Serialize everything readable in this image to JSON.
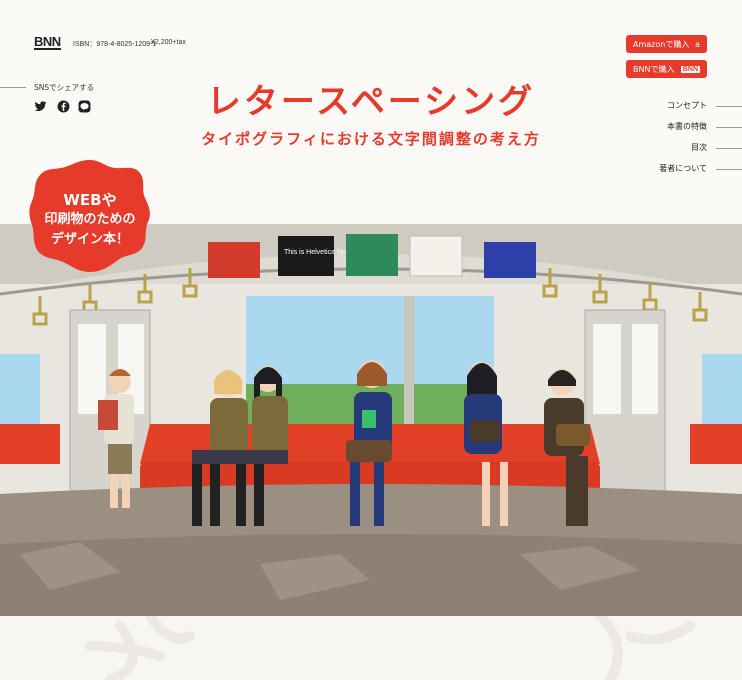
{
  "header": {
    "logo": "BNN",
    "isbn": "ISBN：978-4-8025-1209-1",
    "price": "¥2,200+tax",
    "share_label": "SNSでシェアする",
    "title": "レタースペーシング",
    "subtitle": "タイポグラフィにおける文字間調整の考え方"
  },
  "social": [
    {
      "icon": "twitter-icon"
    },
    {
      "icon": "facebook-icon"
    },
    {
      "icon": "line-icon"
    }
  ],
  "buy": {
    "amazon_label": "Amazonで購入",
    "bnn_label": "BNNで購入",
    "bnn_mark": "BNN"
  },
  "nav": [
    "コンセプト",
    "本書の特徴",
    "目次",
    "著者について"
  ],
  "badge": {
    "line1": "WEBや",
    "line2": "印刷物のための",
    "line3": "デザイン本！"
  },
  "hero": {
    "posters": [
      "This is Helvetica Now."
    ]
  },
  "colors": {
    "accent": "#e63a2b",
    "seat": "#e24128",
    "wall": "#e8e6df"
  }
}
